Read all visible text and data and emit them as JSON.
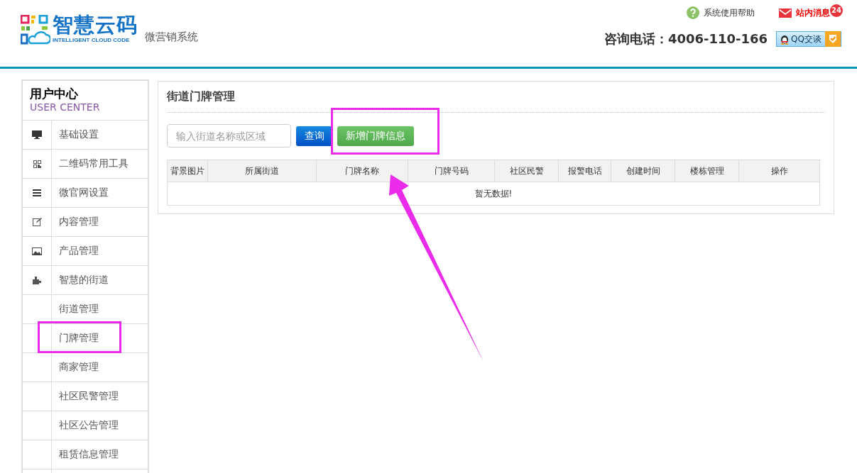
{
  "header": {
    "logo_title": "智慧云码",
    "logo_subtitle": "INTELLIGENT CLOUD CODE",
    "system_name": "微营销系统",
    "help_link": "系统使用帮助",
    "messages_link": "站内消息",
    "messages_count": "24",
    "phone_label": "咨询电话：4006-110-166",
    "qq_button": "QQ交谈"
  },
  "sidebar": {
    "title": "用户中心",
    "subtitle": "USER CENTER",
    "items": [
      {
        "label": "基础设置"
      },
      {
        "label": "二维码常用工具"
      },
      {
        "label": "微官网设置"
      },
      {
        "label": "内容管理"
      },
      {
        "label": "产品管理"
      },
      {
        "label": "智慧的街道",
        "children": [
          {
            "label": "街道管理",
            "highlighted": false
          },
          {
            "label": "门牌管理",
            "highlighted": true
          },
          {
            "label": "商家管理",
            "highlighted": false
          },
          {
            "label": "社区民警管理",
            "highlighted": false
          },
          {
            "label": "社区公告管理",
            "highlighted": false
          },
          {
            "label": "租赁信息管理",
            "highlighted": false
          }
        ]
      }
    ]
  },
  "panel": {
    "title": "街道门牌管理",
    "search": {
      "placeholder": "输入街道名称或区域"
    },
    "query_button": "查询",
    "add_button": {
      "label": "新增门牌信息",
      "highlighted": true
    },
    "table": {
      "columns": [
        "背景图片",
        "所属街道",
        "门牌名称",
        "门牌号码",
        "社区民警",
        "报警电话",
        "创建时间",
        "楼栋管理",
        "操作"
      ],
      "empty_text": "暂无数据!"
    }
  }
}
